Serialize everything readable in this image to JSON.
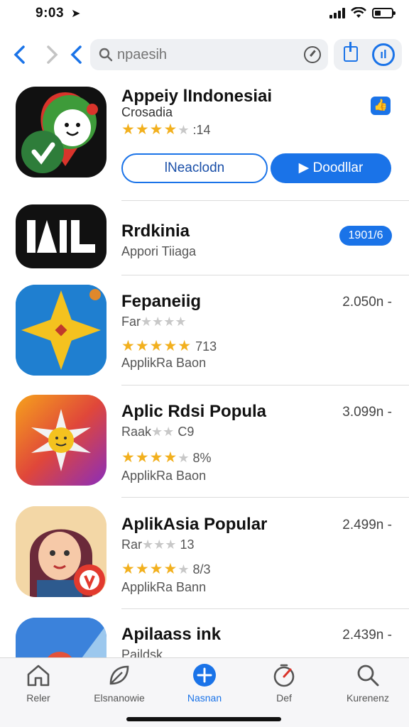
{
  "status": {
    "time": "9:03"
  },
  "search": {
    "placeholder": "npaesih"
  },
  "apps": [
    {
      "title": "Appeiy lIndonesiai",
      "subtitle": "Crosadia",
      "rating_text": ":14",
      "install_label": "lNeaclodn",
      "download_label": "Doodllar"
    },
    {
      "title": "Rrdkinia",
      "subtitle": "Appori Tiiaga",
      "badge": "1901/6"
    },
    {
      "title": "Fepaneiig",
      "subtitle": "Far",
      "rating_text": "713",
      "category": "ApplikRa Baon",
      "size": "2.050n -"
    },
    {
      "title": "Aplic Rdsi Popula",
      "subtitle": "Raak",
      "subtitle_rating": "C9",
      "rating_text": "8%",
      "category": "ApplikRa Baon",
      "size": "3.099n -"
    },
    {
      "title": "AplikAsia Popular",
      "subtitle": "Rar",
      "subtitle_rating": "13",
      "rating_text": "8/3",
      "category": "ApplikRa Bann",
      "size": "2.499n -"
    },
    {
      "title": "Apilaass ink",
      "subtitle": "Paildsk",
      "size": "2.439n -"
    }
  ],
  "tabs": [
    {
      "label": "Reler",
      "icon": "home-icon"
    },
    {
      "label": "Elsnanowie",
      "icon": "leaf-icon"
    },
    {
      "label": "Nasnan",
      "icon": "plus-circle-icon"
    },
    {
      "label": "Def",
      "icon": "gauge-icon"
    },
    {
      "label": "Kurenenz",
      "icon": "search-icon"
    }
  ],
  "colors": {
    "accent": "#1a73e8",
    "star": "#f2b01e"
  }
}
